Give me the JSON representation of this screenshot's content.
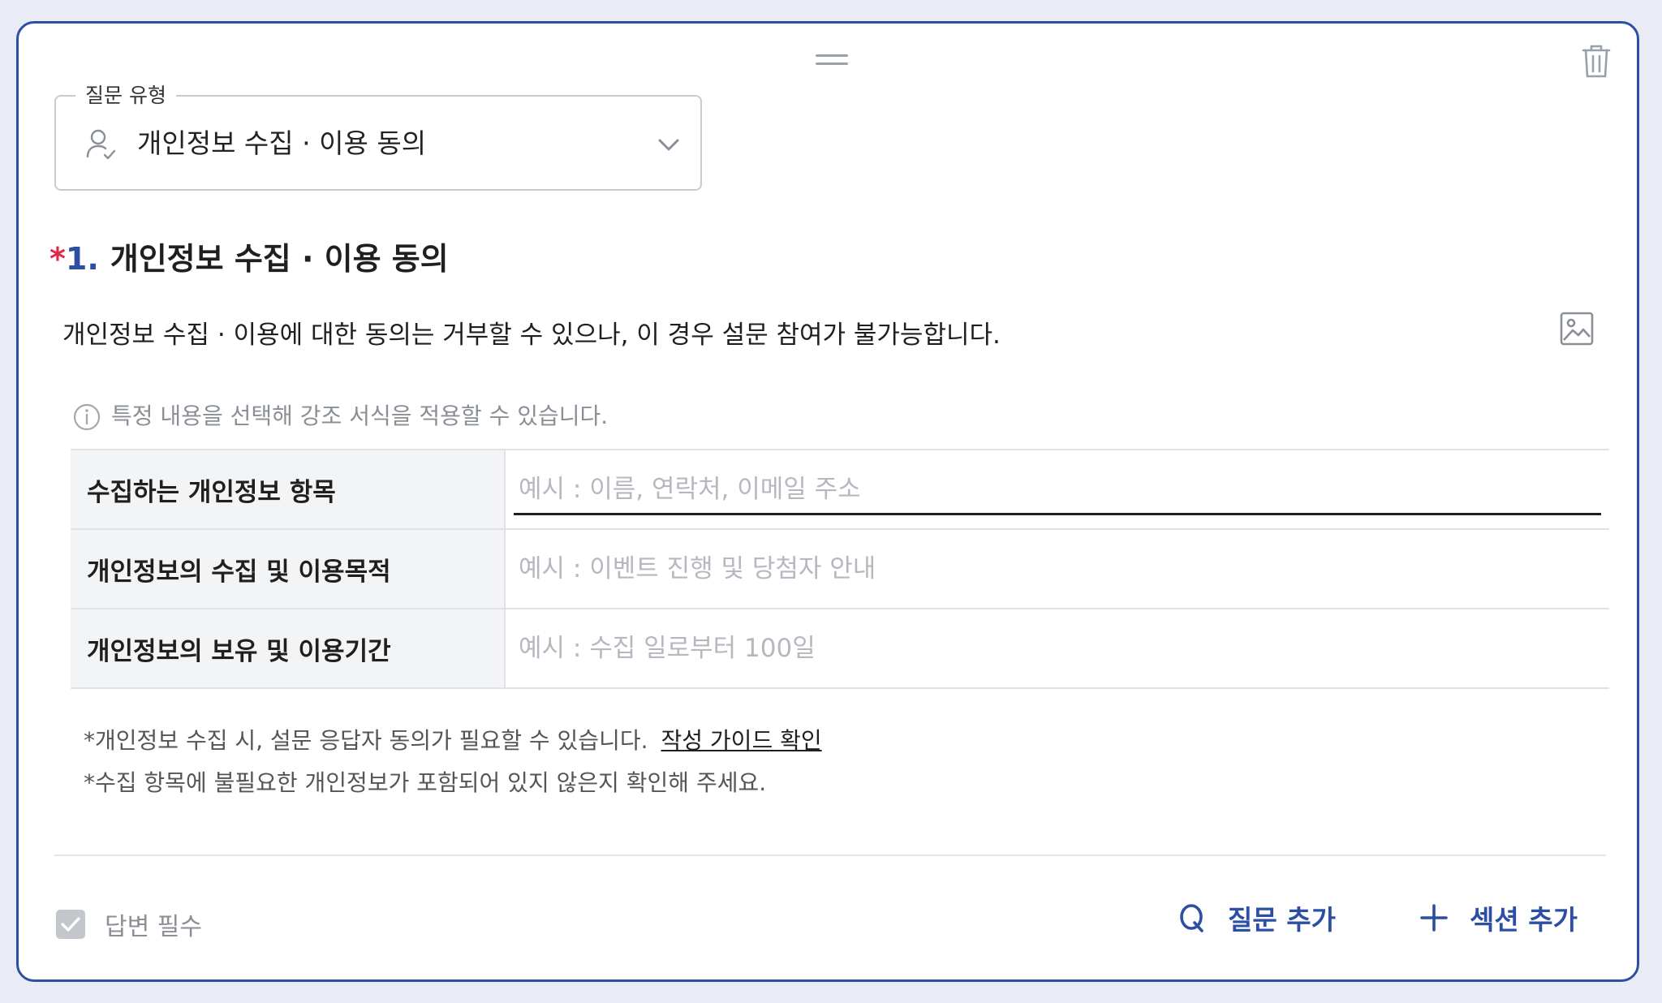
{
  "question_type": {
    "legend": "질문 유형",
    "selected": "개인정보 수집 · 이용 동의"
  },
  "question": {
    "required_mark": "*",
    "number": "1.",
    "title": "개인정보 수집 · 이용 동의",
    "description": "개인정보 수집 · 이용에 대한 동의는 거부할 수 있으나, 이 경우 설문 참여가 불가능합니다."
  },
  "info_text": "특정 내용을 선택해 강조 서식을 적용할 수 있습니다.",
  "table": {
    "rows": [
      {
        "label": "수집하는 개인정보 항목",
        "placeholder": "예시 : 이름, 연락처, 이메일 주소"
      },
      {
        "label": "개인정보의 수집 및 이용목적",
        "placeholder": "예시 : 이벤트 진행 및 당첨자 안내"
      },
      {
        "label": "개인정보의 보유 및 이용기간",
        "placeholder": "예시 : 수집 일로부터 100일"
      }
    ]
  },
  "notes": {
    "note1": "*개인정보 수집 시, 설문 응답자 동의가 필요할 수 있습니다.",
    "guide_link": "작성 가이드 확인",
    "note2": "*수집 항목에 불필요한 개인정보가 포함되어 있지 않은지 확인해 주세요."
  },
  "footer": {
    "required_label": "답변 필수",
    "add_question_label": "질문 추가",
    "add_section_label": "섹션 추가"
  },
  "colors": {
    "accent": "#2d4fa3",
    "required": "#e0284a"
  }
}
